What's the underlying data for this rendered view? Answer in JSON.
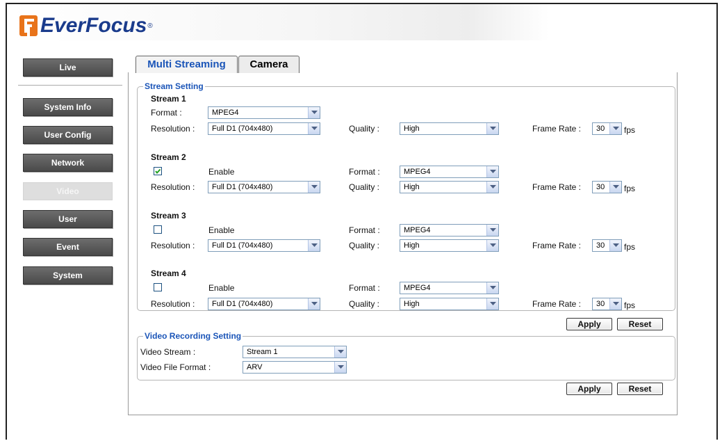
{
  "brand": {
    "name": "EverFocus",
    "reg": "®"
  },
  "nav": [
    {
      "label": "Live",
      "active": false
    },
    {
      "label": "System Info",
      "active": false
    },
    {
      "label": "User Config",
      "active": false
    },
    {
      "label": "Network",
      "active": false
    },
    {
      "label": "Video",
      "active": true
    },
    {
      "label": "User",
      "active": false
    },
    {
      "label": "Event",
      "active": false
    },
    {
      "label": "System",
      "active": false
    }
  ],
  "tabs": [
    {
      "label": "Multi Streaming",
      "active": true
    },
    {
      "label": "Camera",
      "active": false
    }
  ],
  "stream_setting": {
    "legend": "Stream Setting",
    "labels": {
      "format": "Format :",
      "resolution": "Resolution :",
      "quality": "Quality :",
      "frame_rate": "Frame Rate :",
      "enable": "Enable",
      "fps": "fps"
    },
    "streams": [
      {
        "title": "Stream 1",
        "enabled": null,
        "format": "MPEG4",
        "resolution": "Full D1 (704x480)",
        "quality": "High",
        "frame_rate": "30"
      },
      {
        "title": "Stream 2",
        "enabled": true,
        "format": "MPEG4",
        "resolution": "Full D1 (704x480)",
        "quality": "High",
        "frame_rate": "30"
      },
      {
        "title": "Stream 3",
        "enabled": false,
        "format": "MPEG4",
        "resolution": "Full D1 (704x480)",
        "quality": "High",
        "frame_rate": "30"
      },
      {
        "title": "Stream 4",
        "enabled": false,
        "format": "MPEG4",
        "resolution": "Full D1 (704x480)",
        "quality": "High",
        "frame_rate": "30"
      }
    ],
    "apply": "Apply",
    "reset": "Reset"
  },
  "video_recording": {
    "legend": "Video Recording Setting",
    "video_stream_label": "Video Stream :",
    "video_stream_value": "Stream 1",
    "file_format_label": "Video File Format :",
    "file_format_value": "ARV",
    "apply": "Apply",
    "reset": "Reset"
  },
  "colors": {
    "accent": "#1b55b8",
    "logo_orange": "#e8731a",
    "logo_blue": "#1a3b8c"
  }
}
